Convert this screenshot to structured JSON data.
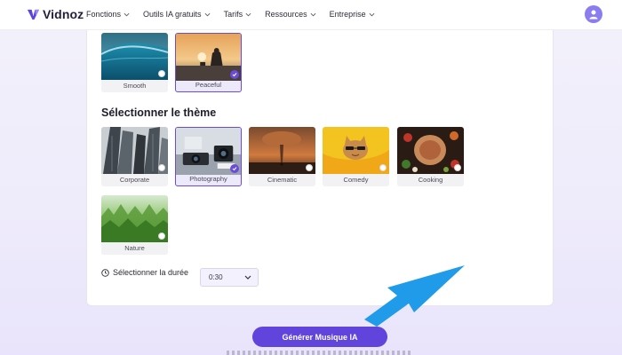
{
  "header": {
    "brand": "Vidnoz",
    "nav": [
      {
        "label": "Fonctions"
      },
      {
        "label": "Outils IA gratuits"
      },
      {
        "label": "Tarifs"
      },
      {
        "label": "Ressources"
      },
      {
        "label": "Entreprise"
      }
    ]
  },
  "moods": [
    {
      "label": "Smooth",
      "selected": false
    },
    {
      "label": "Peaceful",
      "selected": true
    }
  ],
  "theme_section": {
    "title": "Sélectionner le thème",
    "themes": [
      {
        "label": "Corporate",
        "selected": false
      },
      {
        "label": "Photography",
        "selected": true
      },
      {
        "label": "Cinematic",
        "selected": false
      },
      {
        "label": "Comedy",
        "selected": false
      },
      {
        "label": "Cooking",
        "selected": false
      },
      {
        "label": "Nature",
        "selected": false
      }
    ]
  },
  "duration": {
    "label": "Sélectionner la durée",
    "value": "0:30"
  },
  "generate_button": "Générer Musique IA",
  "colors": {
    "accent": "#6044dc",
    "arrow": "#1f9bea"
  }
}
